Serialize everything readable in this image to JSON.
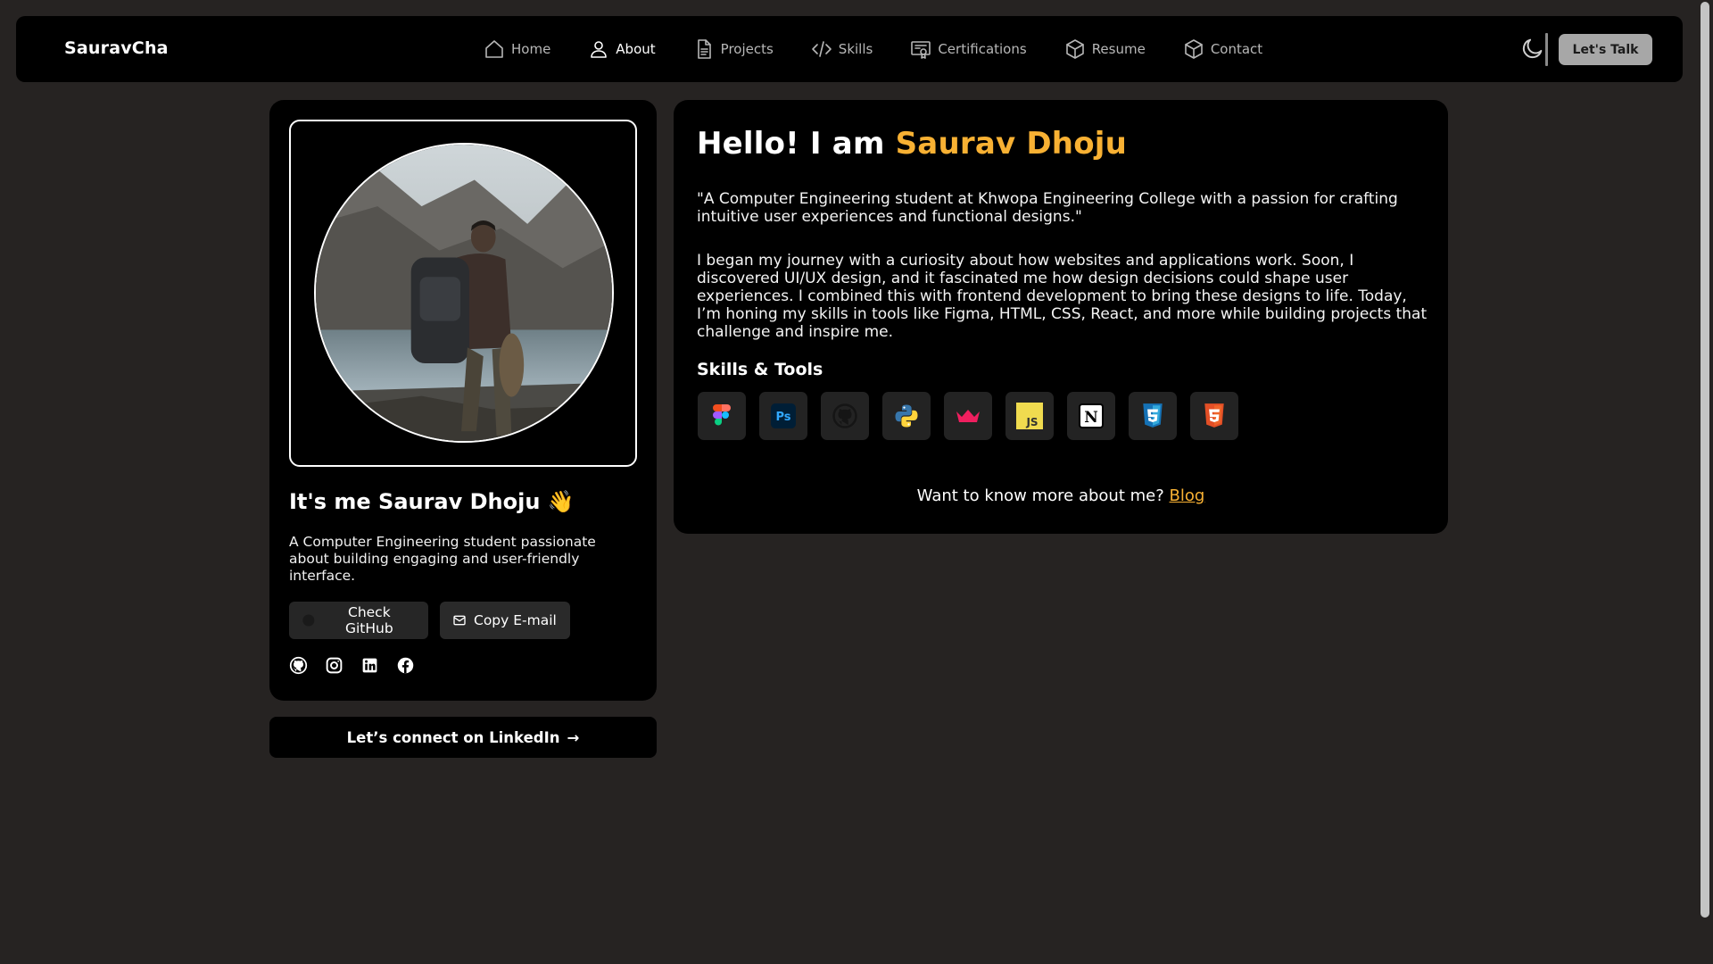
{
  "navbar": {
    "brand": "SauravCha",
    "items": [
      {
        "label": "Home",
        "icon": "home-icon",
        "active": false
      },
      {
        "label": "About",
        "icon": "user-icon",
        "active": true
      },
      {
        "label": "Projects",
        "icon": "document-icon",
        "active": false
      },
      {
        "label": "Skills",
        "icon": "code-icon",
        "active": false
      },
      {
        "label": "Certifications",
        "icon": "certificate-icon",
        "active": false
      },
      {
        "label": "Resume",
        "icon": "box-icon",
        "active": false
      },
      {
        "label": "Contact",
        "icon": "box-icon",
        "active": false
      }
    ],
    "theme_toggle_icon": "moon-icon",
    "cta_label": "Let's Talk"
  },
  "profile": {
    "name": "It's me Saurav Dhoju 👋",
    "bio": "A Computer Engineering student passionate about building engaging and user-friendly interface.",
    "github_button": "Check GitHub",
    "copy_email_button": "Copy E-mail",
    "socials": [
      "github-icon",
      "instagram-icon",
      "linkedin-icon",
      "facebook-icon"
    ],
    "linkedin_cta": "Let’s connect on LinkedIn",
    "linkedin_arrow": "→"
  },
  "about": {
    "heading_prefix": "Hello! I am ",
    "heading_name": "Saurav Dhoju",
    "quote": "\"A Computer Engineering student at Khwopa Engineering College with a passion for crafting intuitive user experiences and functional designs.\"",
    "story": "I began my journey with a curiosity about how websites and applications work. Soon, I discovered UI/UX design, and it fascinated me how design decisions could shape user experiences. I combined this with frontend development to bring these designs to life. Today, I’m honing my skills in tools like Figma, HTML, CSS, React, and more while building projects that challenge and inspire me.",
    "skills_title": "Skills & Tools",
    "skills": [
      "figma-icon",
      "photoshop-icon",
      "github-icon",
      "python-icon",
      "crown-icon",
      "javascript-icon",
      "notion-icon",
      "css3-icon",
      "html5-icon"
    ],
    "more_prefix": "Want to know more about me?",
    "more_link": "Blog"
  },
  "colors": {
    "accent": "#f8b133",
    "background": "#262322",
    "card": "#000000"
  }
}
